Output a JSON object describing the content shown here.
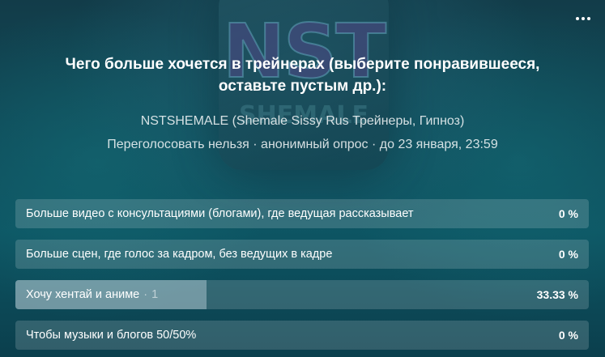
{
  "poll": {
    "question": "Чего больше хочется в трейнерах (выберите понравившееся, оставьте пустым др.):",
    "author": "NSTSHEMALE (Shemale Sissy Rus Трейнеры, Гипноз)",
    "meta": "Переголосовать нельзя · анонимный опрос · до 23 января, 23:59",
    "cover": {
      "logo_text": "NST",
      "logo_sub": "SHEMALE"
    },
    "menu_icon": "more-horizontal-icon",
    "options": [
      {
        "label": "Больше видео с консультациями (блогами), где ведущая рассказывает",
        "count": "",
        "percent": "0 %",
        "share": 0
      },
      {
        "label": "Больше сцен, где голос за кадром, без ведущих в кадре",
        "count": "",
        "percent": "0 %",
        "share": 0
      },
      {
        "label": "Хочу хентай и аниме",
        "count": "1",
        "percent": "33.33 %",
        "share": 0.3333
      },
      {
        "label": "Чтобы музыки и блогов 50/50%",
        "count": "",
        "percent": "0 %",
        "share": 0
      }
    ]
  }
}
